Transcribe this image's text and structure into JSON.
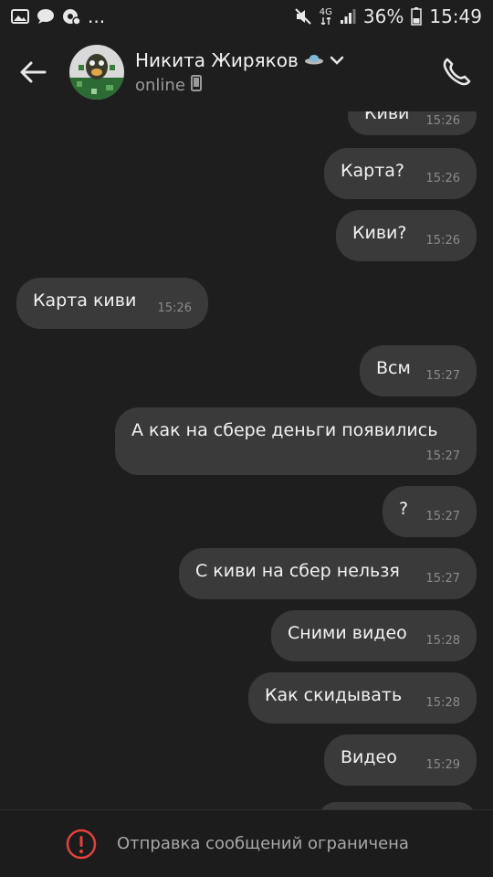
{
  "status_bar": {
    "left_icons": [
      "gallery-icon",
      "chat-icon",
      "settings-notification-icon"
    ],
    "more": "...",
    "right_icons": [
      "mute-icon",
      "lte-icon",
      "signal-icon"
    ],
    "network": "4G",
    "battery_percent": "36%",
    "time": "15:49"
  },
  "header": {
    "contact_name": "Никита Жиряков",
    "status": "online",
    "colors": {
      "back": "#e8e8e8",
      "call": "#e8e8e8"
    }
  },
  "messages": [
    {
      "text": "Киви",
      "time": "15:26",
      "side": "out"
    },
    {
      "text": "Карта?",
      "time": "15:26",
      "side": "out"
    },
    {
      "text": "Киви?",
      "time": "15:26",
      "side": "out"
    },
    {
      "text": "Карта киви",
      "time": "15:26",
      "side": "in"
    },
    {
      "text": "Всм",
      "time": "15:27",
      "side": "out"
    },
    {
      "text": "А как на  сбере деньги появились",
      "time": "15:27",
      "side": "out"
    },
    {
      "text": "?",
      "time": "15:27",
      "side": "out"
    },
    {
      "text": "С киви на сбер нельзя",
      "time": "15:27",
      "side": "out"
    },
    {
      "text": "Сними видео",
      "time": "15:28",
      "side": "out"
    },
    {
      "text": "Как скидывать",
      "time": "15:28",
      "side": "out"
    },
    {
      "text": "Видео",
      "time": "15:29",
      "side": "out"
    }
  ],
  "bottom_bar": {
    "notice": "Отправка сообщений ограничена",
    "icon_color": "#e0433b"
  }
}
